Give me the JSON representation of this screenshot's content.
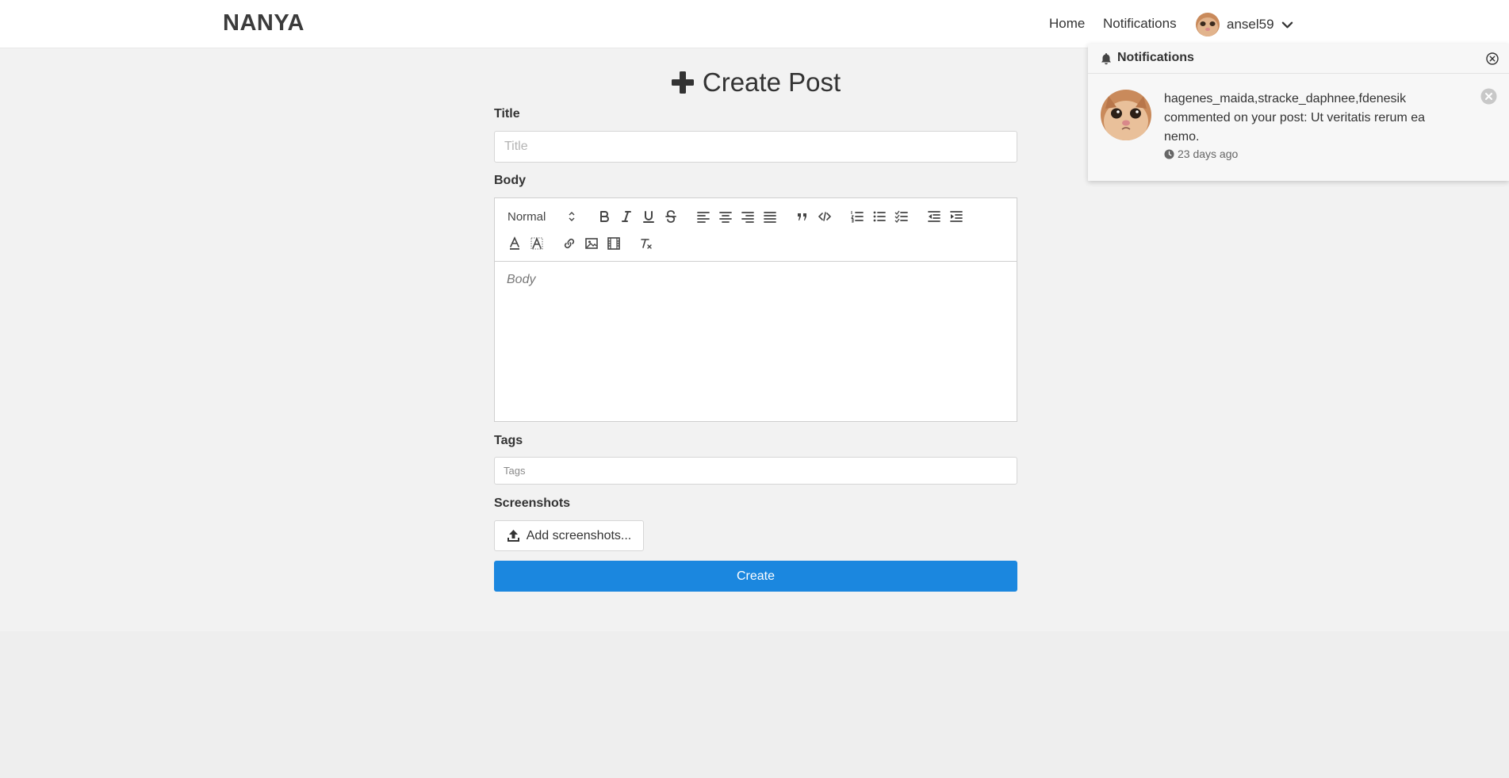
{
  "navbar": {
    "brand": "NANYA",
    "links": {
      "home": "Home",
      "notifications": "Notifications"
    },
    "user": {
      "name": "ansel59"
    }
  },
  "form": {
    "heading": "Create Post",
    "title_label": "Title",
    "title_placeholder": "Title",
    "body_label": "Body",
    "body_placeholder": "Body",
    "header_select_value": "Normal",
    "tags_label": "Tags",
    "tags_placeholder": "Tags",
    "screenshots_label": "Screenshots",
    "upload_button": "Add screenshots...",
    "submit_button": "Create"
  },
  "notifications": {
    "title": "Notifications",
    "items": [
      {
        "text": "hagenes_maida,stracke_daphnee,fdenesik commented on your post: Ut veritatis rerum ea nemo.",
        "time": "23 days ago"
      }
    ]
  },
  "colors": {
    "primary": "#1b87df",
    "page_bg": "#f2f2f2"
  }
}
